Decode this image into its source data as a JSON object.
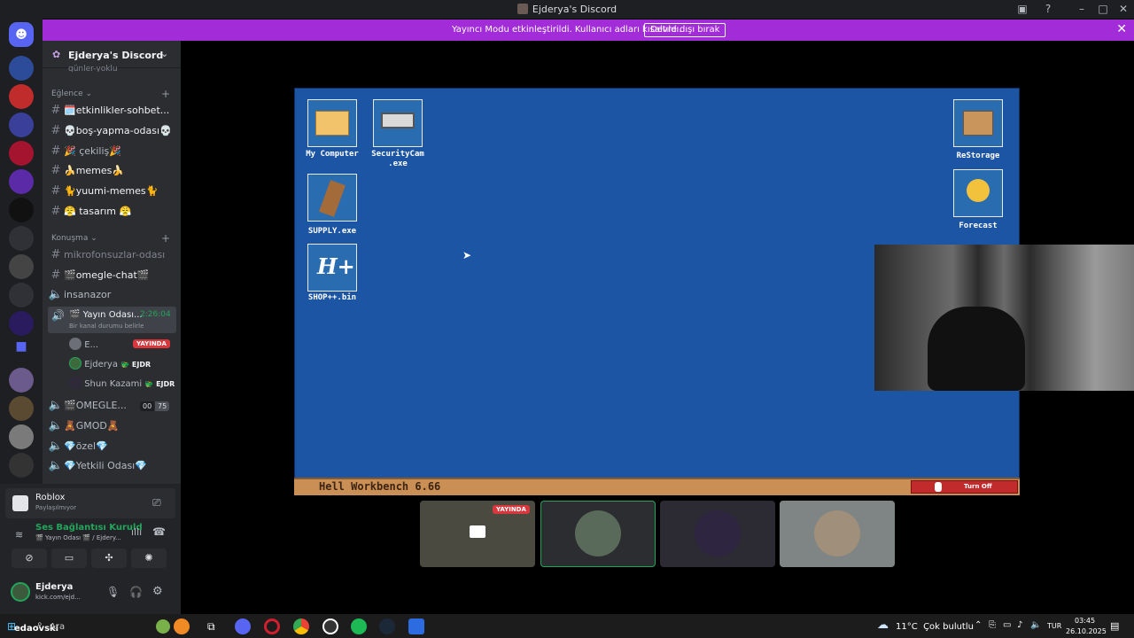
{
  "window": {
    "title": "Ejderya's Discord"
  },
  "banner": {
    "message": "Yayıncı Modu etkinleştirildi. Kullanıcı adları kısaltıldı.",
    "button": "Devre dışı bırak"
  },
  "guild": {
    "name": "Ejderya's Discord"
  },
  "channels": {
    "partial_top": "günler-yoklu",
    "cat1": "Eğlence",
    "text1": [
      {
        "label": "🗓️etkinlikler-sohbet..."
      },
      {
        "label": "💀boş-yapma-odası💀"
      },
      {
        "label": "🎉 çekiliş🎉"
      },
      {
        "label": "🍌memes🍌"
      },
      {
        "label": "🐈yuumi-memes🐈"
      },
      {
        "label": "😤 tasarım 😤"
      }
    ],
    "cat2": "Konuşma",
    "mikrofonsuz": "mikrofonsuzlar-odası",
    "omegle_chat": "🎬omegle-chat🎬",
    "insanazor": "insanazor",
    "yayin_odasi": "🎬 Yayın Odası...",
    "yayin_time": "2:26:04",
    "status_hint": "Bir kanal durumu belirle",
    "members": [
      {
        "name": "E...",
        "badge": "YAYINDA"
      },
      {
        "name": "Ejderya",
        "tag": "🐲 EJDR"
      },
      {
        "name": "Shun Kazami",
        "tag": "🐲 EJDR"
      }
    ],
    "omegle_voice": "🎬OMEGLE...",
    "omegle_counts": [
      "00",
      "75"
    ],
    "gmod": "🧸GMOD🧸",
    "ozel": "💎özel💎",
    "yetkili": "💎Yetkili Odası💎"
  },
  "activity": {
    "game": "Roblox",
    "sub": "Paylaşılmıyor"
  },
  "voice": {
    "status": "Ses Bağlantısı Kuruld",
    "channel": "🎬 Yayın Odası 🎬 / Ejdery..."
  },
  "user": {
    "name": "Ejderya",
    "status": "kick.com/ejd..."
  },
  "stream": {
    "icons": [
      {
        "label": "My Computer"
      },
      {
        "label": "SecurityCam\n.exe"
      },
      {
        "label": "SUPPLY.exe"
      },
      {
        "label": "SHOP++.bin"
      },
      {
        "label": "ReStorage"
      },
      {
        "label": "Forecast"
      }
    ],
    "bar_title": "Hell Workbench 6.66",
    "turn_off": "Turn Off"
  },
  "tiles": [
    {
      "badge": "YAYINDA"
    }
  ],
  "taskbar": {
    "search": "Ara",
    "edge_text": "edaovski",
    "weather": "11°C  Çok bulutlu",
    "lang": "TUR",
    "time": "03:45",
    "date": "26.10.2025"
  },
  "colors": {
    "banner": "#a22cd7",
    "accent_green": "#23a55a",
    "live_red": "#da373c",
    "desktop_blue": "#1d55a5"
  }
}
